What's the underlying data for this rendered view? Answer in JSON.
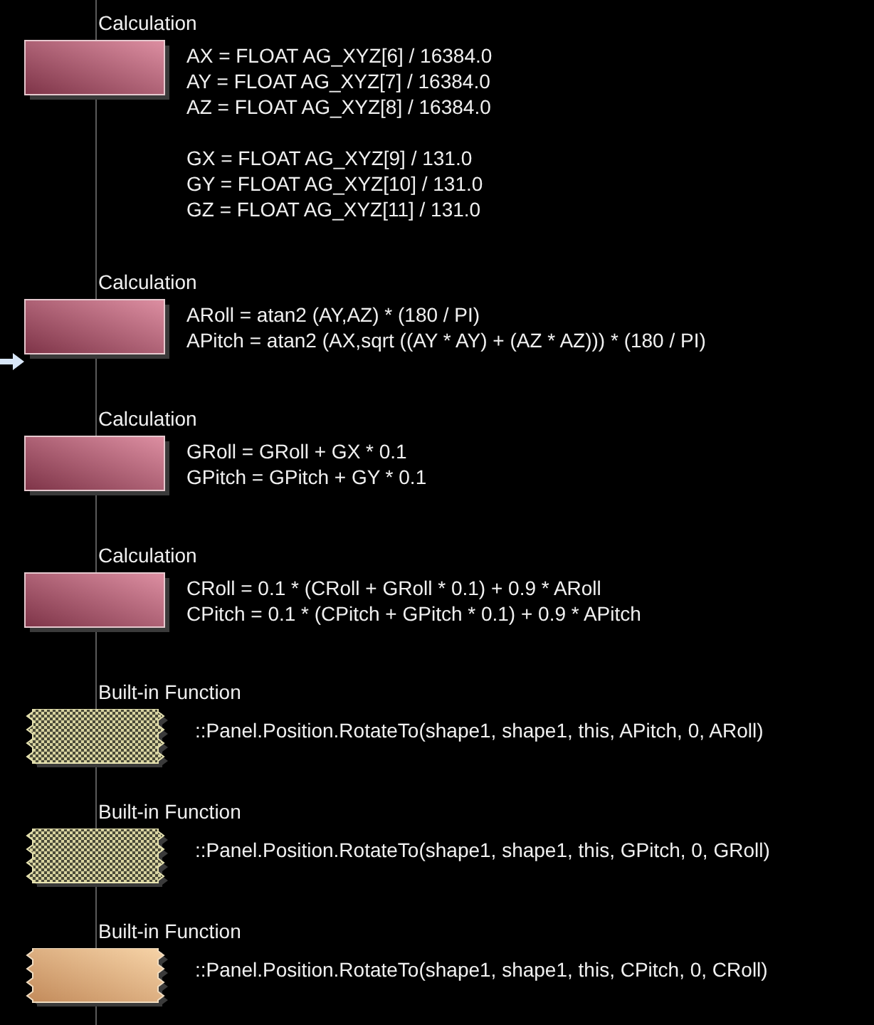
{
  "blocks": [
    {
      "kind": "calculation",
      "title": "Calculation",
      "pointer": false,
      "groups": [
        [
          "AX = FLOAT AG_XYZ[6] / 16384.0",
          "AY = FLOAT AG_XYZ[7] / 16384.0",
          "AZ = FLOAT AG_XYZ[8] / 16384.0"
        ],
        [
          "GX = FLOAT AG_XYZ[9] / 131.0",
          "GY = FLOAT AG_XYZ[10] / 131.0",
          "GZ = FLOAT AG_XYZ[11] / 131.0"
        ]
      ]
    },
    {
      "kind": "calculation",
      "title": "Calculation",
      "pointer": true,
      "groups": [
        [
          "ARoll = atan2 (AY,AZ) * (180 / PI)",
          "APitch = atan2 (AX,sqrt ((AY * AY) + (AZ * AZ))) * (180 / PI)"
        ]
      ]
    },
    {
      "kind": "calculation",
      "title": "Calculation",
      "pointer": false,
      "groups": [
        [
          "GRoll = GRoll + GX * 0.1",
          "GPitch = GPitch + GY * 0.1"
        ]
      ]
    },
    {
      "kind": "calculation",
      "title": "Calculation",
      "pointer": false,
      "groups": [
        [
          "CRoll = 0.1 * (CRoll + GRoll * 0.1) + 0.9 * ARoll",
          "CPitch = 0.1 * (CPitch + GPitch * 0.1) + 0.9 * APitch"
        ]
      ]
    },
    {
      "kind": "builtin",
      "title": "Built-in Function",
      "disabled": true,
      "pointer": false,
      "groups": [
        [
          "::Panel.Position.RotateTo(shape1, shape1, this, APitch, 0, ARoll)"
        ]
      ]
    },
    {
      "kind": "builtin",
      "title": "Built-in Function",
      "disabled": true,
      "pointer": false,
      "groups": [
        [
          "::Panel.Position.RotateTo(shape1, shape1, this, GPitch, 0, GRoll)"
        ]
      ]
    },
    {
      "kind": "builtin",
      "title": "Built-in Function",
      "disabled": false,
      "pointer": false,
      "groups": [
        [
          "::Panel.Position.RotateTo(shape1, shape1, this, CPitch, 0, CRoll)"
        ]
      ]
    }
  ]
}
